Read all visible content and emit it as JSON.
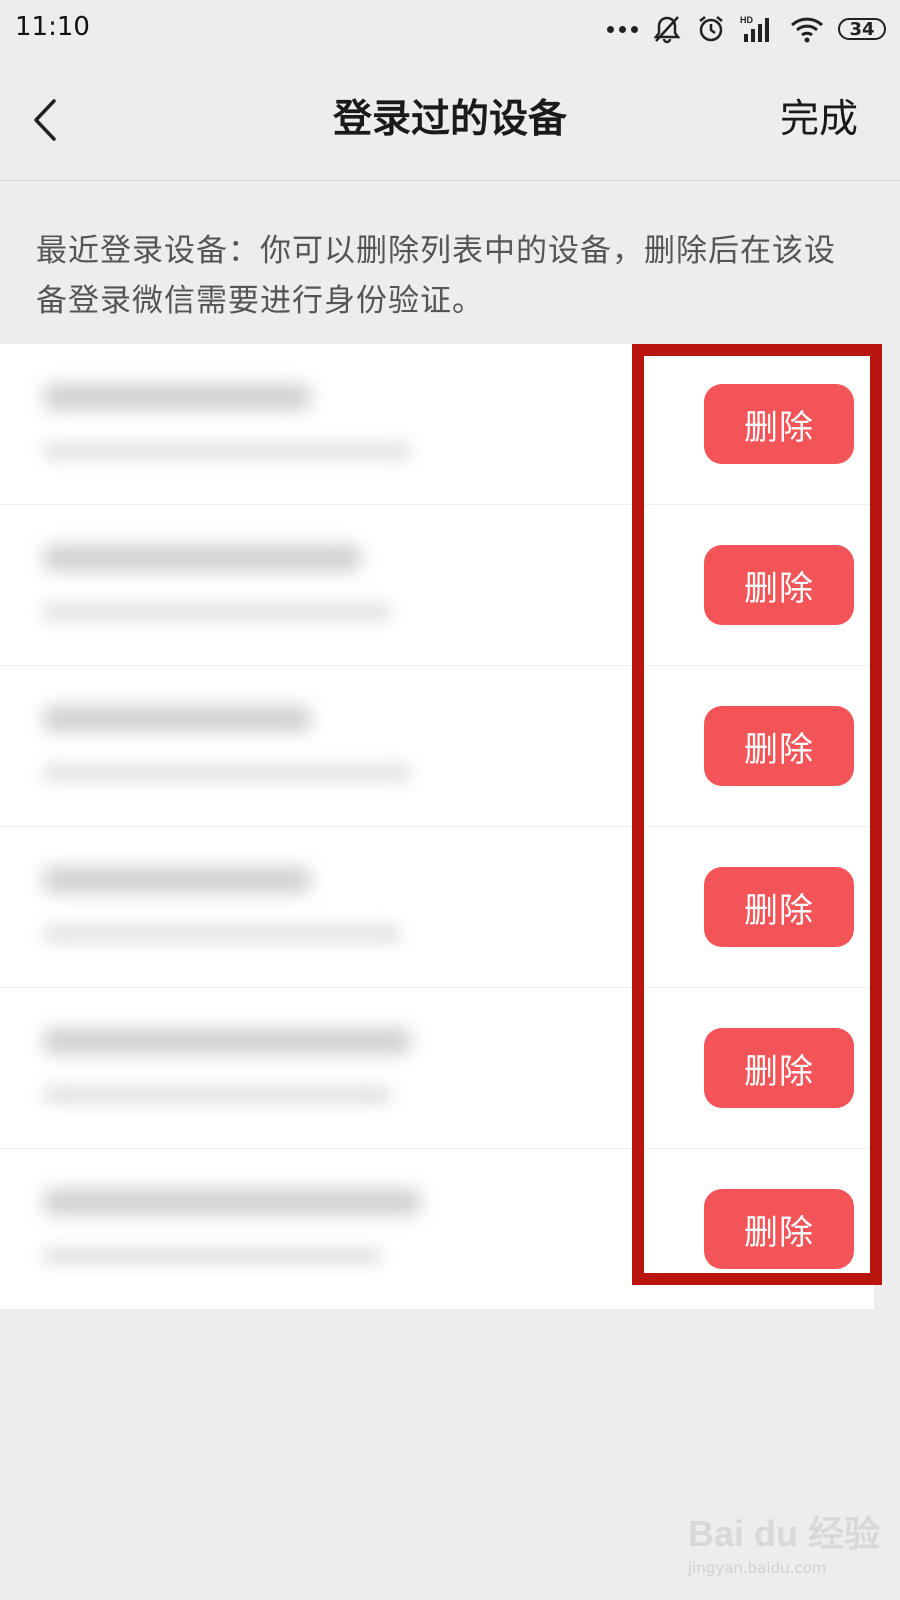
{
  "status_bar": {
    "time": "11:10",
    "battery": "34",
    "icons": [
      "more-dots-icon",
      "mute-bell-icon",
      "alarm-icon",
      "hd-signal-icon",
      "wifi-icon",
      "battery-icon"
    ]
  },
  "nav": {
    "title": "登录过的设备",
    "done_label": "完成",
    "back_icon": "chevron-left-icon"
  },
  "description": "最近登录设备：你可以删除列表中的设备，删除后在该设备登录微信需要进行身份验证。",
  "devices": [
    {
      "delete_label": "删除"
    },
    {
      "delete_label": "删除"
    },
    {
      "delete_label": "删除"
    },
    {
      "delete_label": "删除"
    },
    {
      "delete_label": "删除"
    },
    {
      "delete_label": "删除"
    }
  ],
  "colors": {
    "delete_button": "#f25457",
    "annotation_box": "#b8150f",
    "background": "#ededed"
  },
  "watermark": {
    "logo": "Bai du 经验",
    "url": "jingyan.baidu.com"
  }
}
